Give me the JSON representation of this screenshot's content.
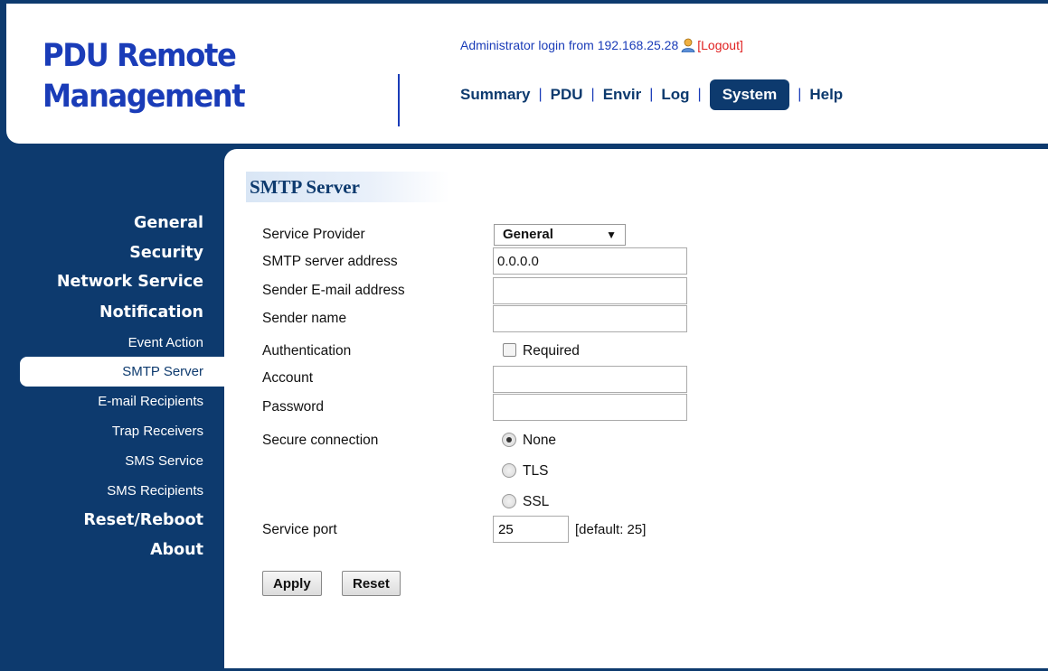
{
  "header": {
    "logo_line1": "PDU Remote",
    "logo_line2": "Management",
    "login_prefix": "Administrator login from 192.168.25.28",
    "logout": "[Logout]",
    "nav": [
      "Summary",
      "PDU",
      "Envir",
      "Log",
      "System",
      "Help"
    ],
    "active_nav": "System"
  },
  "sidebar": {
    "items": [
      {
        "label": "General",
        "level": "main"
      },
      {
        "label": "Security",
        "level": "main"
      },
      {
        "label": "Network Service",
        "level": "main"
      },
      {
        "label": "Notification",
        "level": "main"
      },
      {
        "label": "Event Action",
        "level": "sub"
      },
      {
        "label": "SMTP Server",
        "level": "sub",
        "active": true
      },
      {
        "label": "E-mail Recipients",
        "level": "sub"
      },
      {
        "label": "Trap Receivers",
        "level": "sub"
      },
      {
        "label": "SMS Service",
        "level": "sub"
      },
      {
        "label": "SMS Recipients",
        "level": "sub"
      },
      {
        "label": "Reset/Reboot",
        "level": "main"
      },
      {
        "label": "About",
        "level": "main"
      }
    ]
  },
  "form": {
    "title": "SMTP Server",
    "service_provider_label": "Service Provider",
    "service_provider_value": "General",
    "smtp_address_label": "SMTP server address",
    "smtp_address_value": "0.0.0.0",
    "sender_email_label": "Sender E-mail address",
    "sender_email_value": "",
    "sender_name_label": "Sender name",
    "sender_name_value": "",
    "auth_label": "Authentication",
    "auth_option": "Required",
    "auth_checked": false,
    "account_label": "Account",
    "account_value": "",
    "password_label": "Password",
    "password_value": "",
    "secure_label": "Secure connection",
    "secure_options": [
      "None",
      "TLS",
      "SSL"
    ],
    "secure_selected": "None",
    "port_label": "Service port",
    "port_value": "25",
    "port_hint": "[default: 25]",
    "apply": "Apply",
    "reset": "Reset"
  },
  "colors": {
    "navy": "#0d3a6e",
    "logo_blue": "#1a3cb8",
    "logout_red": "#e02020"
  }
}
